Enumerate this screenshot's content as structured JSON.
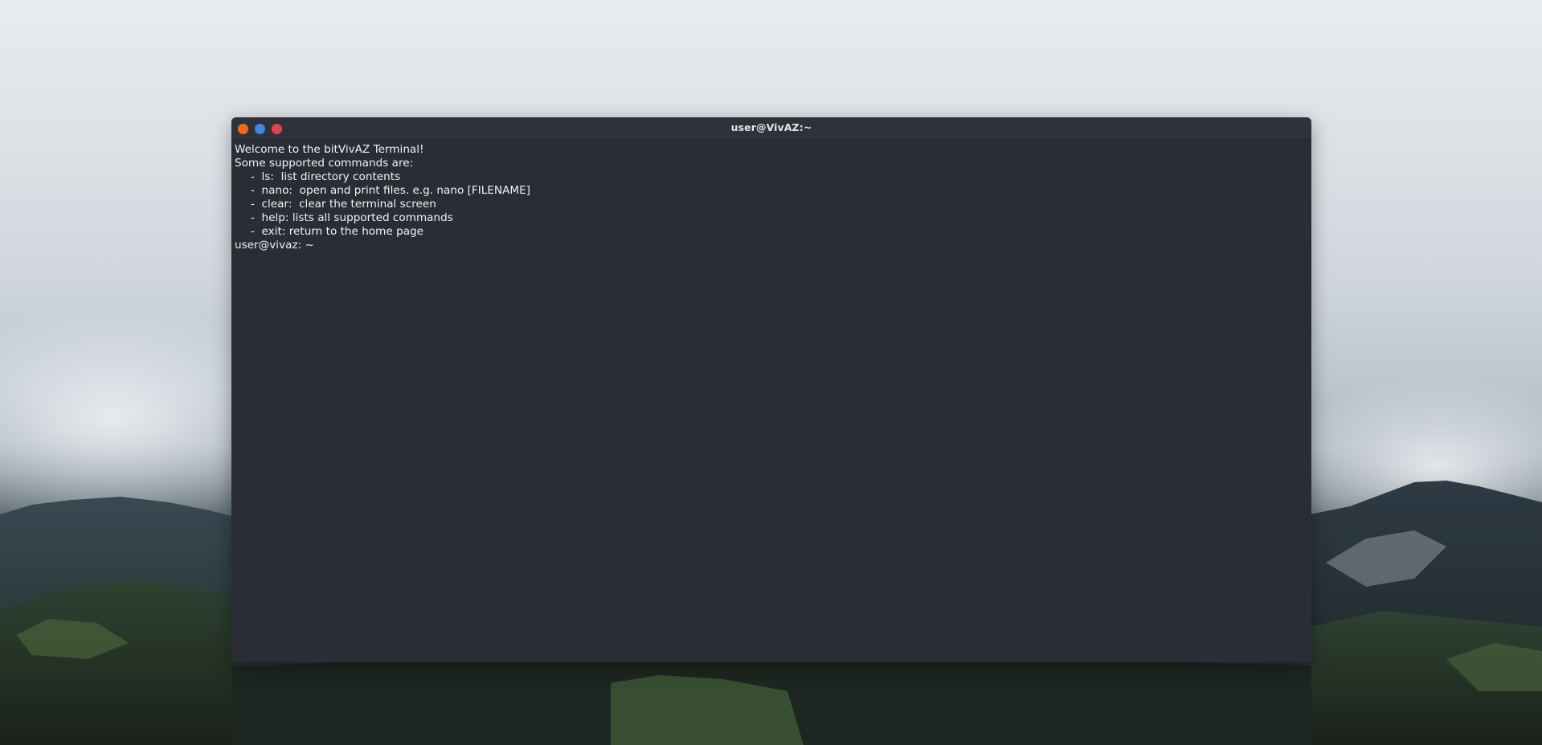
{
  "window": {
    "title": "user@VivAZ:~",
    "buttons": {
      "minimize_color": "#f26a1b",
      "maximize_color": "#3f86e0",
      "close_color": "#e0454f"
    }
  },
  "terminal": {
    "welcome": "Welcome to the bitVivAZ Terminal!",
    "intro": "Some supported commands are:",
    "commands": [
      "-  ls:  list directory contents",
      "-  nano:  open and print files. e.g. nano [FILENAME]",
      "-  clear:  clear the terminal screen",
      "-  help: lists all supported commands",
      "-  exit: return to the home page"
    ],
    "prompt": "user@vivaz: ~",
    "input_value": ""
  },
  "colors": {
    "terminal_bg": "#2a2d35",
    "titlebar_bg": "#2f323b",
    "text": "#f2f2f2"
  }
}
